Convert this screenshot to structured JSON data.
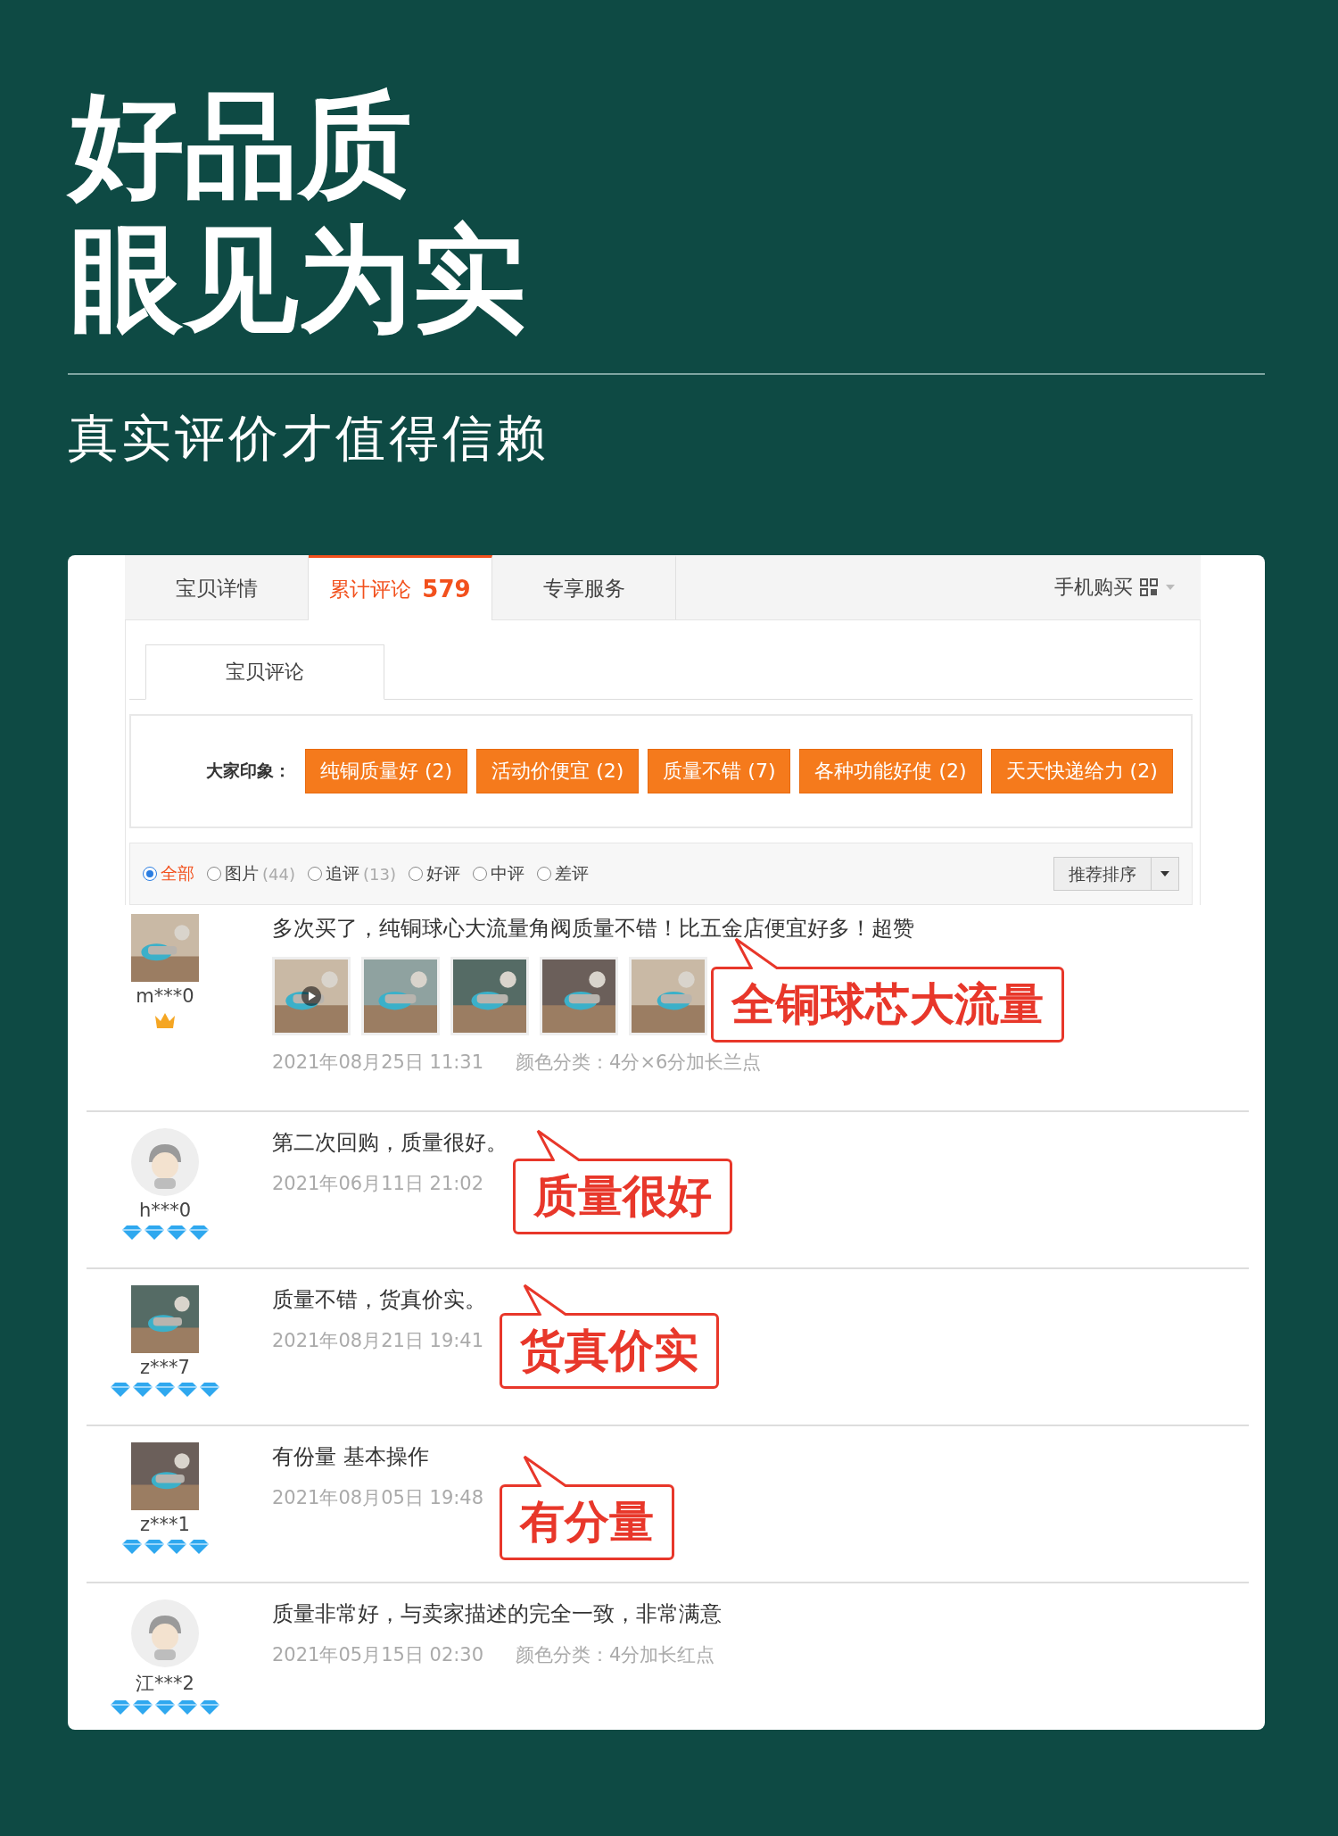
{
  "headline": [
    "好品质",
    "眼见为实"
  ],
  "subtitle": "真实评价才值得信赖",
  "tabs": [
    {
      "label": "宝贝详情",
      "selected": false
    },
    {
      "label": "累计评论",
      "count": "579",
      "selected": true
    },
    {
      "label": "专享服务",
      "selected": false
    }
  ],
  "mobile_buy": "手机购买",
  "subtab": "宝贝评论",
  "impressions": {
    "label": "大家印象：",
    "tags": [
      "纯铜质量好 (2)",
      "活动价便宜 (2)",
      "质量不错 (7)",
      "各种功能好使 (2)",
      "天天快递给力 (2)"
    ]
  },
  "filters": [
    {
      "label": "全部",
      "selected": true
    },
    {
      "label": "图片",
      "count": "(44)",
      "selected": false
    },
    {
      "label": "追评",
      "count": "(13)",
      "selected": false
    },
    {
      "label": "好评",
      "selected": false
    },
    {
      "label": "中评",
      "selected": false
    },
    {
      "label": "差评",
      "selected": false
    }
  ],
  "sort": "推荐排序",
  "reviews": [
    {
      "user": "m***0",
      "avatar": {
        "kind": "picture"
      },
      "rank": {
        "kind": "crown"
      },
      "text": "多次买了，纯铜球心大流量角阀质量不错！比五金店便宜好多！超赞",
      "photos": [
        {
          "video": true
        },
        {
          "video": false
        },
        {
          "video": false
        },
        {
          "video": false
        },
        {
          "video": false
        }
      ],
      "date": "2021年08月25日 11:31",
      "sku": "颜色分类：4分×6分加长兰点",
      "callout": "全铜球芯大流量"
    },
    {
      "user": "h***0",
      "avatar": {
        "kind": "default"
      },
      "rank": {
        "kind": "diamond",
        "stars": 4
      },
      "text": "第二次回购，质量很好。",
      "date": "2021年06月11日 21:02",
      "callout": "质量很好"
    },
    {
      "user": "z***7",
      "avatar": {
        "kind": "picture"
      },
      "rank": {
        "kind": "diamond",
        "stars": 5
      },
      "text": "质量不错，货真价实。",
      "date": "2021年08月21日 19:41",
      "callout": "货真价实"
    },
    {
      "user": "z***1",
      "avatar": {
        "kind": "picture"
      },
      "rank": {
        "kind": "diamond",
        "stars": 4
      },
      "text": "有份量 基本操作",
      "date": "2021年08月05日 19:48",
      "callout": "有分量"
    },
    {
      "user": "江***2",
      "avatar": {
        "kind": "default"
      },
      "rank": {
        "kind": "diamond",
        "stars": 5
      },
      "text": "质量非常好，与卖家描述的完全一致，非常满意",
      "date": "2021年05月15日 02:30",
      "sku": "颜色分类：4分加长红点"
    }
  ]
}
